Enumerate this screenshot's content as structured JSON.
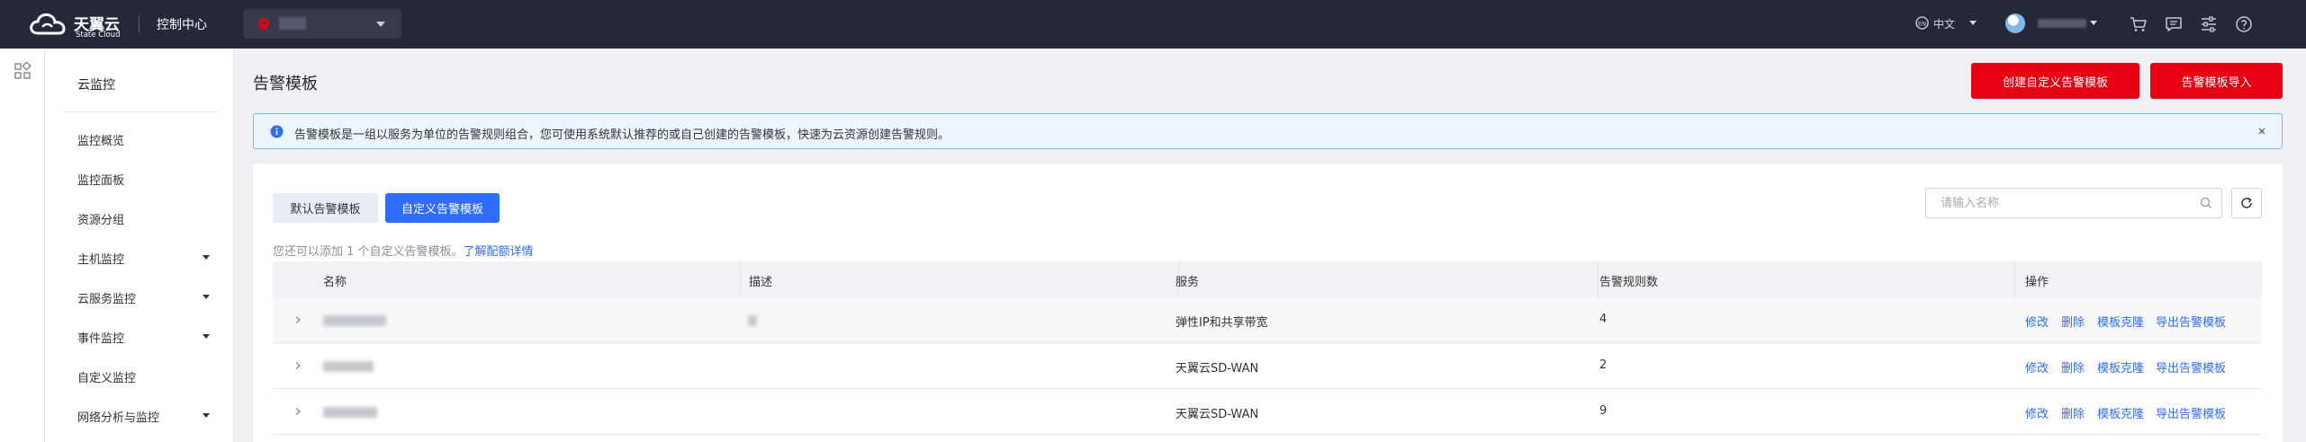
{
  "topbar": {
    "logo_text": "天翼云",
    "logo_sub": "State Cloud",
    "console_title": "控制中心",
    "language": "中文",
    "icons": [
      "cart-icon",
      "message-icon",
      "settings-sliders-icon",
      "help-icon"
    ]
  },
  "sidebar": {
    "title": "云监控",
    "items": [
      {
        "label": "监控概览",
        "has_submenu": false
      },
      {
        "label": "监控面板",
        "has_submenu": false
      },
      {
        "label": "资源分组",
        "has_submenu": false
      },
      {
        "label": "主机监控",
        "has_submenu": true
      },
      {
        "label": "云服务监控",
        "has_submenu": true
      },
      {
        "label": "事件监控",
        "has_submenu": true
      },
      {
        "label": "自定义监控",
        "has_submenu": false
      },
      {
        "label": "网络分析与监控",
        "has_submenu": true
      }
    ]
  },
  "page": {
    "title": "告警模板",
    "create_button": "创建自定义告警模板",
    "import_button": "告警模板导入",
    "notice": "告警模板是一组以服务为单位的告警规则组合，您可使用系统默认推荐的或自己创建的告警模板，快速为云资源创建告警规则。"
  },
  "tabs": {
    "default": "默认告警模板",
    "custom": "自定义告警模板",
    "active": "custom"
  },
  "search": {
    "placeholder": "请输入名称"
  },
  "quota": {
    "text": "您还可以添加 1 个自定义告警模板。",
    "link": "了解配额详情"
  },
  "table": {
    "headers": {
      "name": "名称",
      "description": "描述",
      "service": "服务",
      "rule_count": "告警规则数",
      "actions": "操作"
    },
    "rows": [
      {
        "service": "弹性IP和共享带宽",
        "rule_count": "4"
      },
      {
        "service": "天翼云SD-WAN",
        "rule_count": "2"
      },
      {
        "service": "天翼云SD-WAN",
        "rule_count": "9"
      }
    ],
    "row_actions": {
      "edit": "修改",
      "delete": "删除",
      "clone": "模板克隆",
      "export": "导出告警模板"
    }
  },
  "colors": {
    "topbar_bg": "#252838",
    "primary_red": "#e60012",
    "primary_blue": "#2f6bff",
    "notice_bg": "#edf6ff",
    "notice_border": "#7ab9ef"
  }
}
